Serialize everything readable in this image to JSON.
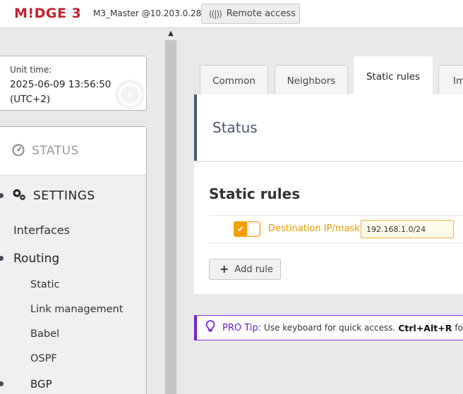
{
  "header": {
    "logo": "M!DGE 3",
    "unit_name": "M3_Master @10.203.0.28",
    "remote_access_label": "Remote access"
  },
  "sidebar": {
    "unit_time_label": "Unit time:",
    "unit_time_value": "2025-06-09 13:56:50",
    "unit_time_zone": "(UTC+2)",
    "status_label": "STATUS",
    "settings_label": "SETTINGS",
    "items": {
      "interfaces": "Interfaces",
      "routing": "Routing",
      "static": "Static",
      "link_management": "Link management",
      "babel": "Babel",
      "ospf": "OSPF",
      "bgp": "BGP"
    }
  },
  "tabs": [
    "Common",
    "Neighbors",
    "Static rules",
    "Im"
  ],
  "active_tab": "Static rules",
  "status_card": {
    "title": "Status"
  },
  "rules_card": {
    "title": "Static rules",
    "rule": {
      "enabled": true,
      "label": "Destination IP/mask",
      "value": "192.168.1.0/24"
    },
    "add_rule_label": "Add rule"
  },
  "tip": {
    "head": "PRO Tip:",
    "text": "Use keyboard for quick access.",
    "shortcut": "Ctrl+Alt+R",
    "tail": "for"
  },
  "colors": {
    "brand": "#c3202f",
    "accent": "#f2a000",
    "tip": "#7b1fd1",
    "status_bar": "#4b5670"
  }
}
